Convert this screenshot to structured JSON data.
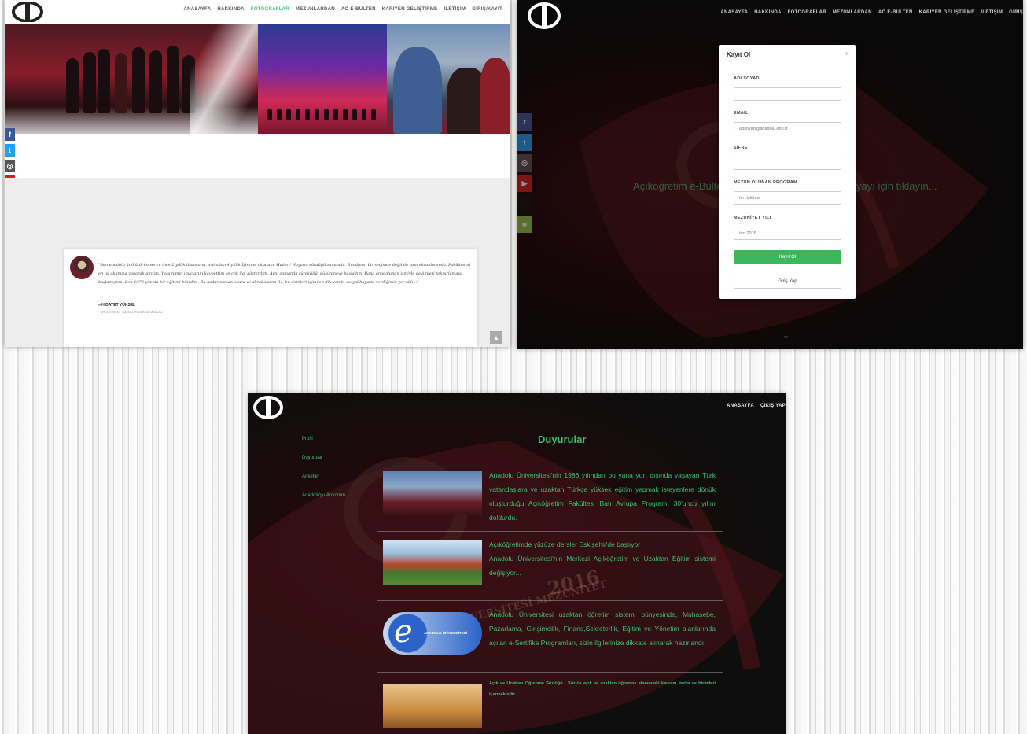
{
  "brand": {
    "logo_colors": {
      "dark": "#222222",
      "light": "#ffffff"
    },
    "accent_green": "#3cc27a",
    "social_colors": [
      "#3b5998",
      "#1da1f2",
      "#555555",
      "#cc2222",
      "#111111",
      "#8bc34a"
    ],
    "social_icons": [
      "facebook-icon",
      "twitter-icon",
      "instagram-icon",
      "youtube-icon",
      "apple-icon",
      "android-icon"
    ],
    "social_glyphs": [
      "f",
      "t",
      "◎",
      "▶",
      "",
      "☻"
    ]
  },
  "shot1": {
    "nav": [
      "ANASAYFA",
      "HAKKINDA",
      "FOTOĞRAFLAR",
      "MEZUNLARDAN",
      "AÖ E-BÜLTEN",
      "KARİYER GELİŞTİRME",
      "İLETİŞİM",
      "GİRİŞ/KAYIT"
    ],
    "active_nav": "FOTOĞRAFLAR",
    "testimonial": {
      "quote": "\"Ben anadolu ünikütürün sonra ince 2 yıllık lisansının, ardından 4 yıllık İşletme okudum. Haden! Hayatın sürdüğü zamanda. Bundanın bir seçimde değil de işim ekranlarımda. Fakültesini en iyi aklımıza yaparak girdim. Yaşamımın ipuçlarını kaybettim ve çok ilgi gösterdim. Aynı zamanda sürekliliği düşünmeye başladım. Bana anadolunun ismiyle deyimleri tekrarlamaya başlamıştım. Ben 1978 yılında bir eğitimi bitirdim. Bu kadar zaman sonra ve akrabalarım ile, bu dersleri içimden dileyerek, sosyal hayatta verdiğimiz yer aldı...\"",
      "author": "» HIDAYET YÜKSEL",
      "meta": "20.10.2015 · İşletme Fakültesi Mezunu"
    },
    "totop_glyph": "▲"
  },
  "shot2": {
    "nav": [
      "ANASAYFA",
      "HAKKINDA",
      "FOTOĞRAFLAR",
      "MEZUNLARDAN",
      "AÖ E-BÜLTEN",
      "KARİYER GELİŞTİRME",
      "İLETİŞİM",
      "GİRİŞ"
    ],
    "bg_text_left": "Açıköğretim e-Bülten",
    "bg_text_right": "yayı için tıklayın...",
    "modal": {
      "title": "Kayıt Ol",
      "close": "×",
      "fields": [
        {
          "label": "ADI SOYADI",
          "placeholder": ""
        },
        {
          "label": "EMAIL",
          "placeholder": "adsoyad@anadolu.edu.tr"
        },
        {
          "label": "ŞİFRE",
          "placeholder": ""
        },
        {
          "label": "MEZUN OLUNAN PROGRAM",
          "placeholder": "örn:İşletme"
        },
        {
          "label": "MEZUNİYET YILI",
          "placeholder": "örn:2016"
        }
      ],
      "submit": "Kayıt Ol",
      "login": "Giriş Yap"
    },
    "scroll_glyph": "⌄"
  },
  "shot3": {
    "nav": [
      "ANASAYFA",
      "ÇIKIŞ YAP"
    ],
    "title": "Duyurular",
    "side_menu": [
      "Profil",
      "Duyurular",
      "Anketler",
      "Anadolu'yu Arıyorum"
    ],
    "embroidery_year": "2016",
    "embroidery_text": "ANADOLU ÜNİVERSİTESİ MEZUNİYET TÖRENİ",
    "news": [
      {
        "text": "Anadolu Üniversitesi'nin 1986 yılından bu yana yurt dışında yaşayan Türk vatandaşlara ve uzaktan Türkçe yüksek eğitim yapmak isteyenlere dönük oluşturduğu Açıköğretim Fakültesi Batı Avrupa Programı 30'uncu yılını doldurdu."
      },
      {
        "text": "Açıköğretimde yüzüze dersler Eskişehir'de başlıyor\nAnadolu Üniversitesi'nin Merkezi Açıköğretim ve Uzaktan Eğitim sistemi değişiyor..."
      },
      {
        "text": "Anadolu Üniversitesi uzaktan öğretim sistemi bünyesinde, Muhasebe, Pazarlama, Girişimcilik, Finans,Sekreterlik, Eğitim ve Yönetim alanlarında açılan e-Sertifika Programları, sizin ilgilerinize dikkate alınarak hazırlandı."
      },
      {
        "text": "Açık ve Uzaktan Öğrenme Sözlüğü · Sözlük açık ve uzaktan öğrenme alanındaki kavram, terim ve birimleri içermektedir."
      }
    ],
    "eprog_label": "ANADOLU ÜNİVERSİTESİ",
    "eprog_letter": "e"
  }
}
